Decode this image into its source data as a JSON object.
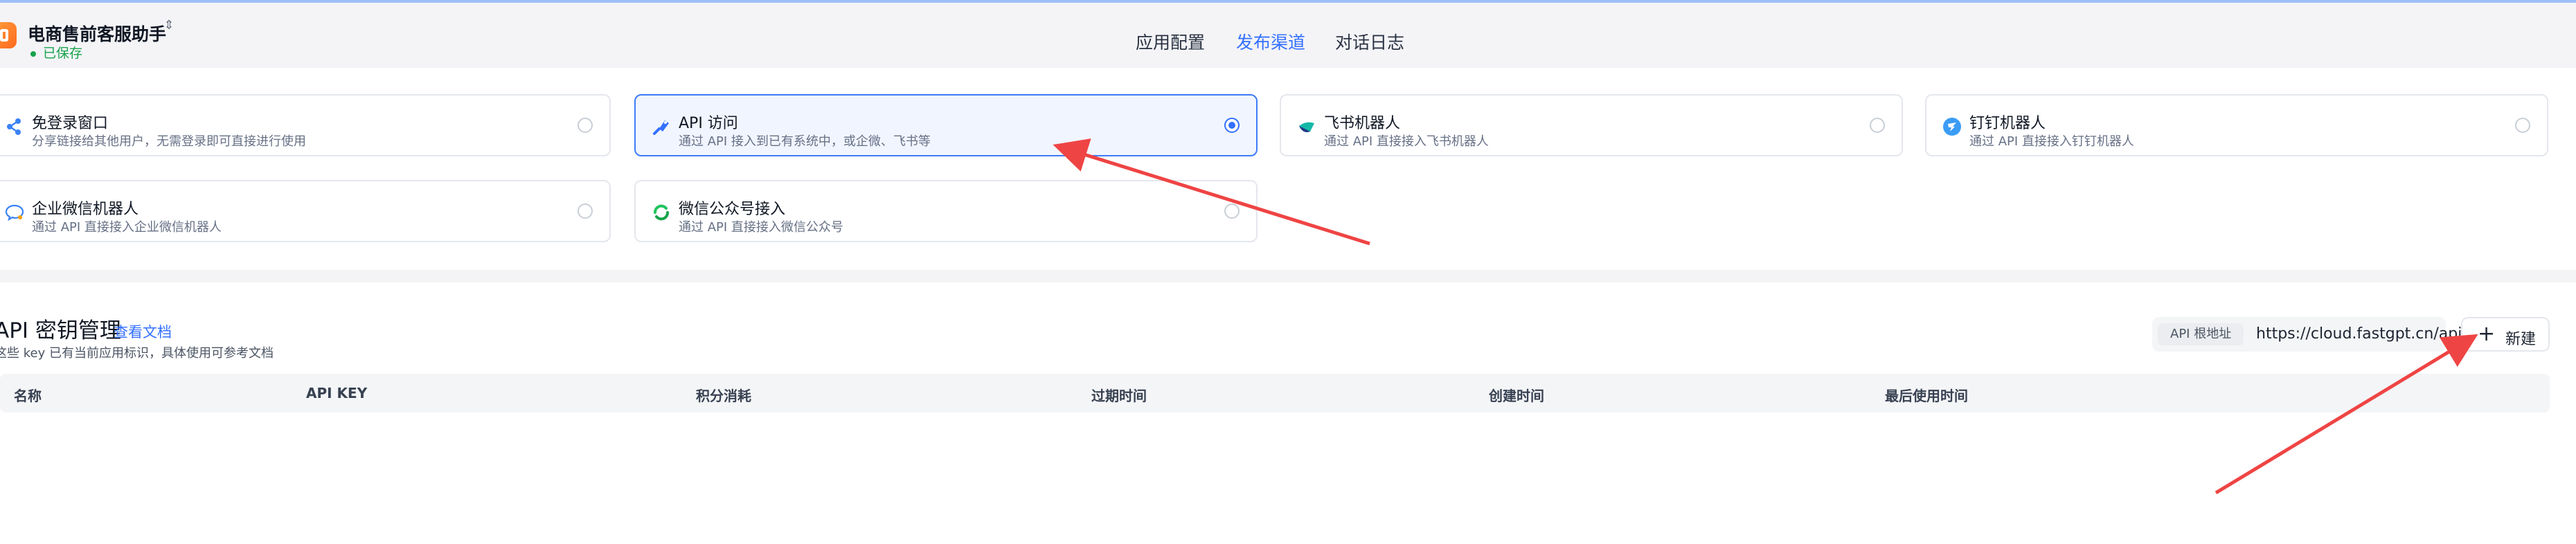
{
  "app": {
    "title": "电商售前客服助手",
    "saved_status": "已保存",
    "saved_color": "#16a34a"
  },
  "nav": {
    "tabs": [
      {
        "label": "应用配置",
        "active": false
      },
      {
        "label": "发布渠道",
        "active": true
      },
      {
        "label": "对话日志",
        "active": false
      }
    ],
    "accent": "#3370ff"
  },
  "channels": [
    {
      "name": "免登录窗口",
      "desc": "分享链接给其他用户，无需登录即可直接进行使用",
      "icon": "share-icon",
      "selected": false
    },
    {
      "name": "API 访问",
      "desc": "通过 API 接入到已有系统中，或企微、飞书等",
      "icon": "api-icon",
      "selected": true
    },
    {
      "name": "飞书机器人",
      "desc": "通过 API 直接接入飞书机器人",
      "icon": "feishu-icon",
      "selected": false
    },
    {
      "name": "钉钉机器人",
      "desc": "通过 API 直接接入钉钉机器人",
      "icon": "dingtalk-icon",
      "selected": false
    },
    {
      "name": "企业微信机器人",
      "desc": "通过 API 直接接入企业微信机器人",
      "icon": "wecom-icon",
      "selected": false
    },
    {
      "name": "微信公众号接入",
      "desc": "通过 API 直接接入微信公众号",
      "icon": "wechat-official-icon",
      "selected": false
    }
  ],
  "api_keys": {
    "title": "API 密钥管理",
    "doc_link": "查看文档",
    "desc": "这些 key 已有当前应用标识，具体使用可参考文档",
    "base_url_label": "API 根地址",
    "base_url": "https://cloud.fastgpt.cn/api",
    "new_button": "新建",
    "columns": [
      "名称",
      "API KEY",
      "积分消耗",
      "过期时间",
      "创建时间",
      "最后使用时间"
    ]
  },
  "annotation_color": "#ef4444"
}
